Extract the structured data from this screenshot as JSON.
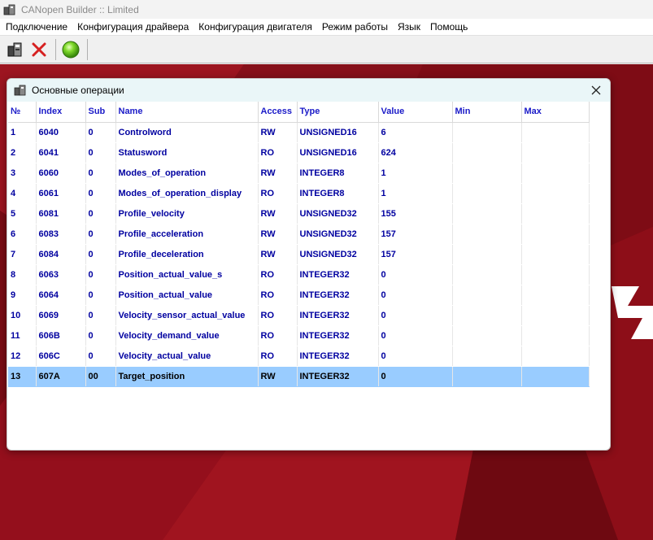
{
  "window": {
    "title": "CANopen Builder :: Limited"
  },
  "menu": [
    "Подключение",
    "Конфигурация драйвера",
    "Конфигурация двигателя",
    "Режим работы",
    "Язык",
    "Помощь"
  ],
  "toolbar": {
    "icons": [
      "connect-icon",
      "disconnect-icon",
      "status-light-icon"
    ],
    "status_color": "#5cc51a"
  },
  "dialog": {
    "title": "Основные операции",
    "columns": [
      "№",
      "Index",
      "Sub",
      "Name",
      "Access",
      "Type",
      "Value",
      "Min",
      "Max"
    ],
    "rows": [
      [
        "1",
        "6040",
        "0",
        "Controlword",
        "RW",
        "UNSIGNED16",
        "6",
        "",
        ""
      ],
      [
        "2",
        "6041",
        "0",
        "Statusword",
        "RO",
        "UNSIGNED16",
        "624",
        "",
        ""
      ],
      [
        "3",
        "6060",
        "0",
        "Modes_of_operation",
        "RW",
        "INTEGER8",
        "1",
        "",
        ""
      ],
      [
        "4",
        "6061",
        "0",
        "Modes_of_operation_display",
        "RO",
        "INTEGER8",
        "1",
        "",
        ""
      ],
      [
        "5",
        "6081",
        "0",
        "Profile_velocity",
        "RW",
        "UNSIGNED32",
        "155",
        "",
        ""
      ],
      [
        "6",
        "6083",
        "0",
        "Profile_acceleration",
        "RW",
        "UNSIGNED32",
        "157",
        "",
        ""
      ],
      [
        "7",
        "6084",
        "0",
        "Profile_deceleration",
        "RW",
        "UNSIGNED32",
        "157",
        "",
        ""
      ],
      [
        "8",
        "6063",
        "0",
        "Position_actual_value_s",
        "RO",
        "INTEGER32",
        "0",
        "",
        ""
      ],
      [
        "9",
        "6064",
        "0",
        "Position_actual_value",
        "RO",
        "INTEGER32",
        "0",
        "",
        ""
      ],
      [
        "10",
        "6069",
        "0",
        "Velocity_sensor_actual_value",
        "RO",
        "INTEGER32",
        "0",
        "",
        ""
      ],
      [
        "11",
        "606B",
        "0",
        "Velocity_demand_value",
        "RO",
        "INTEGER32",
        "0",
        "",
        ""
      ],
      [
        "12",
        "606C",
        "0",
        "Velocity_actual_value",
        "RO",
        "INTEGER32",
        "0",
        "",
        ""
      ],
      [
        "13",
        "607A",
        "00",
        "Target_position",
        "RW",
        "INTEGER32",
        "0",
        "",
        ""
      ]
    ],
    "selected_row": 12
  },
  "colors": {
    "desktop": "#8a1019",
    "header_text": "#1a1ac8",
    "cell_text": "#0000a0",
    "selection": "#99ccff"
  }
}
